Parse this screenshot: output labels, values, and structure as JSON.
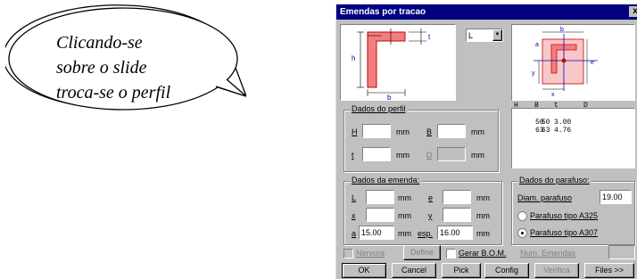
{
  "callout": {
    "lines": [
      "Clicando-se",
      "sobre o slide",
      "troca-se o perfil"
    ]
  },
  "dialog": {
    "title": "Emendas por tracao",
    "close_glyph": "x",
    "profile_select": "L",
    "profile_dropdown_glyph": "▼",
    "diagram_left": {
      "dim_h": "h",
      "dim_b": "b",
      "dim_t": "t"
    },
    "diagram_right": {
      "dim_a": "a",
      "dim_b": "b",
      "dim_e": "e",
      "dim_x": "x",
      "dim_y": "y"
    },
    "profile_list": {
      "headers": [
        "H",
        "B",
        "t",
        "D"
      ],
      "rows": [
        [
          "50",
          "50",
          "3.00",
          ""
        ],
        [
          "63",
          "63",
          "4.76",
          ""
        ]
      ]
    },
    "dados_perfil": {
      "legend": "Dados do perfil",
      "h_label": "H",
      "b_label": "B",
      "t_label": "t",
      "d_label": "D",
      "unit": "mm",
      "h_value": "",
      "b_value": "",
      "t_value": "",
      "d_value": ""
    },
    "dados_emenda": {
      "legend": "Dados da emenda:",
      "l_label": "L",
      "e_label": "e",
      "x_label": "x",
      "y_label": "y",
      "a_label": "a",
      "esp_label": "esp.",
      "unit": "mm",
      "l_value": "",
      "e_value": "",
      "x_value": "",
      "y_value": "",
      "a_value": "15.00",
      "esp_value": "16.00"
    },
    "dados_parafuso": {
      "legend": "Dados do parafuso:",
      "diam_label": "Diam. parafuso",
      "diam_value": "19.00",
      "radio_a325": "Parafuso tipo A325",
      "radio_a307": "Parafuso tipo A307",
      "selected": "A307"
    },
    "options_row": {
      "nervura_label": "Nervura",
      "define_label": "Define",
      "gerar_bom_label": "Gerar B.O.M.",
      "num_emendas_label": "Num. Emendas",
      "num_emendas_value": ""
    },
    "buttons": {
      "ok": "OK",
      "cancel": "Cancel",
      "pick": "Pick",
      "config": "Config",
      "verifica": "Verifica",
      "files": "Files >>"
    },
    "colors": {
      "titlebar": "#000080",
      "face": "#c0c0c0",
      "profile_fill": "#f08080",
      "profile_edge": "#cc0000",
      "bolt_line": "#0000cc"
    }
  }
}
